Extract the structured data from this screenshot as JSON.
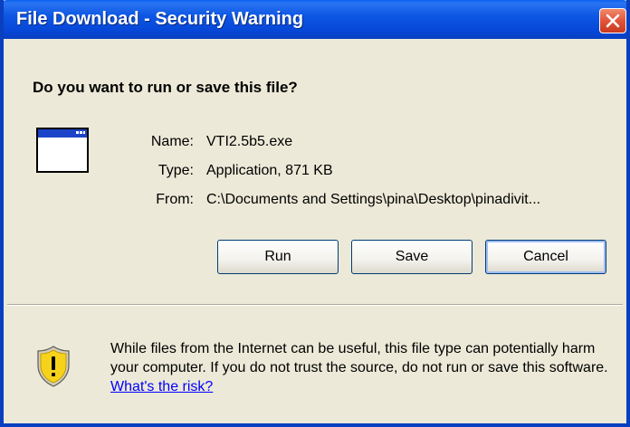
{
  "window": {
    "title": "File Download - Security Warning"
  },
  "dialog": {
    "question": "Do you want to run or save this file?",
    "fields": [
      {
        "label": "Name:",
        "value": "VTI2.5b5.exe"
      },
      {
        "label": "Type:",
        "value": "Application, 871 KB"
      },
      {
        "label": "From:",
        "value": "C:\\Documents and Settings\\pina\\Desktop\\pinadivit..."
      }
    ],
    "buttons": {
      "run": "Run",
      "save": "Save",
      "cancel": "Cancel"
    },
    "warning": {
      "text": "While files from the Internet can be useful, this file type can potentially harm your computer. If you do not trust the source, do not run or save this software.",
      "link": "What's the risk?"
    }
  },
  "icons": {
    "close": "close-icon",
    "file": "application-window-icon",
    "warning": "shield-warning-icon"
  },
  "colors": {
    "titlebar": "#0a54e2",
    "dialog_bg": "#ece9d8",
    "close_btn": "#e2543a",
    "link": "#0000ff"
  }
}
